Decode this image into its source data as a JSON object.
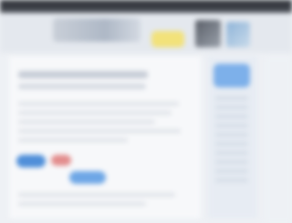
{
  "window": {
    "title": ""
  },
  "header": {
    "logo_text": "",
    "badge_text": ""
  },
  "content": {
    "heading": "",
    "subheading": "",
    "primary_button_label": "",
    "secondary_button_label": "",
    "tertiary_button_label": ""
  },
  "sidebar": {
    "button_label": ""
  },
  "icons": {
    "header_image_1": "image-icon",
    "header_image_2": "image-icon"
  },
  "colors": {
    "accent": "#4f8fd9",
    "badge": "#f2e27a",
    "danger": "#e38d8d"
  }
}
